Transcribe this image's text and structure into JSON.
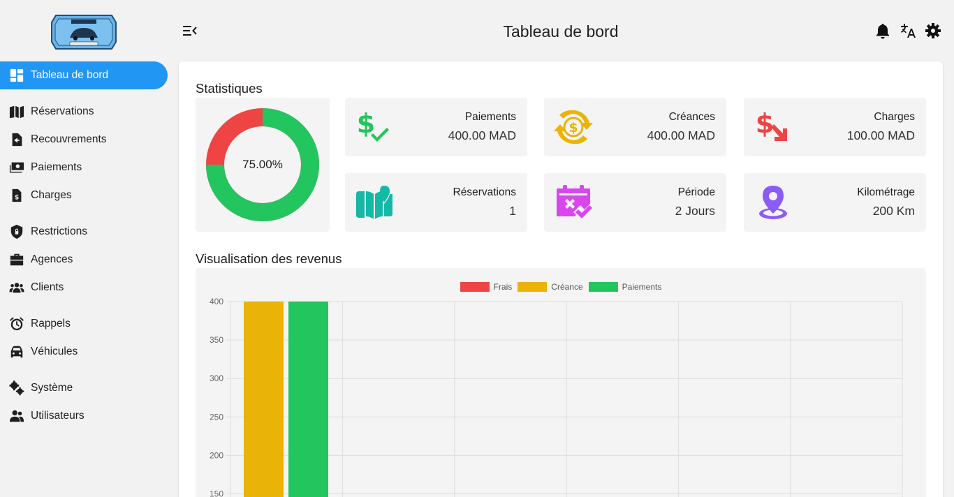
{
  "header": {
    "title": "Tableau de bord"
  },
  "sidebar": {
    "items": [
      {
        "label": "Tableau de bord",
        "icon": "dashboard-icon"
      },
      {
        "label": "Réservations",
        "icon": "book-map-icon"
      },
      {
        "label": "Recouvrements",
        "icon": "file-arrow-icon"
      },
      {
        "label": "Paiements",
        "icon": "money-bill-icon"
      },
      {
        "label": "Charges",
        "icon": "file-dollar-icon"
      },
      {
        "label": "Restrictions",
        "icon": "shield-lock-icon"
      },
      {
        "label": "Agences",
        "icon": "briefcase-icon"
      },
      {
        "label": "Clients",
        "icon": "users-icon"
      },
      {
        "label": "Rappels",
        "icon": "alarm-clock-icon"
      },
      {
        "label": "Véhicules",
        "icon": "car-icon"
      },
      {
        "label": "Système",
        "icon": "gears-icon"
      },
      {
        "label": "Utilisateurs",
        "icon": "user-group-icon"
      }
    ]
  },
  "stats": {
    "title": "Statistiques",
    "donut": {
      "label": "75.00%",
      "fraction": 0.75,
      "colors": [
        "#22c55e",
        "#ef4444"
      ]
    },
    "cards": [
      {
        "label": "Paiements",
        "value": "400.00 MAD",
        "icon": "dollar-check-icon",
        "color": "#22c55e"
      },
      {
        "label": "Créances",
        "value": "400.00 MAD",
        "icon": "dollar-cycle-icon",
        "color": "#eab308"
      },
      {
        "label": "Charges",
        "value": "100.00 MAD",
        "icon": "dollar-down-icon",
        "color": "#ef4444"
      },
      {
        "label": "Réservations",
        "value": "1",
        "icon": "book-map-icon",
        "color": "#14b8a6"
      },
      {
        "label": "Période",
        "value": "2 Jours",
        "icon": "calendar-check-icon",
        "color": "#d946ef"
      },
      {
        "label": "Kilométrage",
        "value": "200 Km",
        "icon": "map-pin-icon",
        "color": "#8b5cf6"
      }
    ]
  },
  "revenue": {
    "title": "Visualisation des revenus"
  },
  "chart_data": {
    "type": "bar",
    "categories": [
      ""
    ],
    "series": [
      {
        "name": "Frais",
        "values": [
          0
        ],
        "color": "#ef4444"
      },
      {
        "name": "Créance",
        "values": [
          400
        ],
        "color": "#eab308"
      },
      {
        "name": "Paiements",
        "values": [
          400
        ],
        "color": "#22c55e"
      }
    ],
    "yticks": [
      "400",
      "350",
      "300",
      "250",
      "200",
      "150"
    ],
    "ylim": [
      0,
      400
    ],
    "grid": true,
    "legend": "top-center"
  }
}
